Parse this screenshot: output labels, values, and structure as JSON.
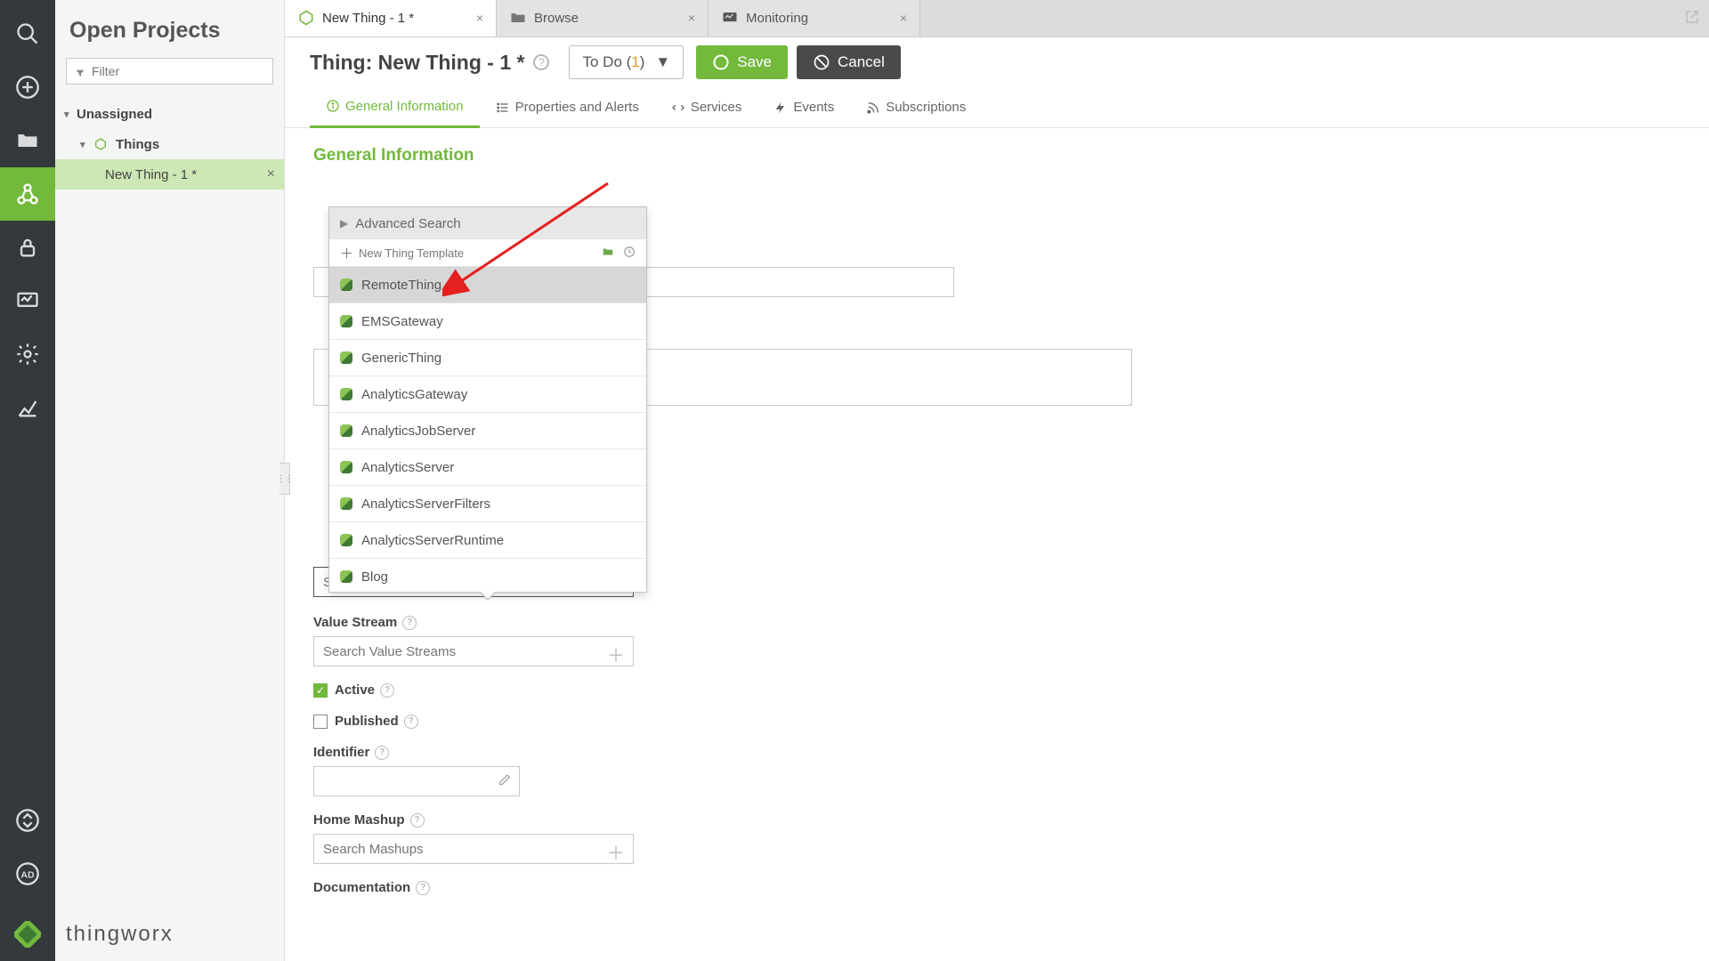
{
  "sidebar": {
    "title": "Open Projects",
    "filter_placeholder": "Filter",
    "tree": {
      "unassigned": "Unassigned",
      "things": "Things",
      "new_thing": "New Thing - 1 *"
    }
  },
  "brand": {
    "text": "thingworx"
  },
  "tabs": [
    {
      "label": "New Thing - 1 *"
    },
    {
      "label": "Browse"
    },
    {
      "label": "Monitoring"
    }
  ],
  "header": {
    "title": "Thing: New Thing - 1 *",
    "todo_label_prefix": "To Do (",
    "todo_count": "1",
    "todo_label_suffix": ")",
    "save": "Save",
    "cancel": "Cancel"
  },
  "etabs": {
    "general": "General Information",
    "props": "Properties and Alerts",
    "services": "Services",
    "events": "Events",
    "subscriptions": "Subscriptions"
  },
  "section_title": "General Information",
  "form": {
    "base_template_placeholder": "Search Thing Templates",
    "value_stream_label": "Value Stream",
    "value_stream_placeholder": "Search Value Streams",
    "active_label": "Active",
    "published_label": "Published",
    "identifier_label": "Identifier",
    "home_mashup_label": "Home Mashup",
    "home_mashup_placeholder": "Search Mashups",
    "documentation_label": "Documentation"
  },
  "popup": {
    "advanced": "Advanced Search",
    "new_template": "New Thing Template",
    "items": [
      "RemoteThing",
      "EMSGateway",
      "GenericThing",
      "AnalyticsGateway",
      "AnalyticsJobServer",
      "AnalyticsServer",
      "AnalyticsServerFilters",
      "AnalyticsServerRuntime",
      "Blog"
    ]
  }
}
